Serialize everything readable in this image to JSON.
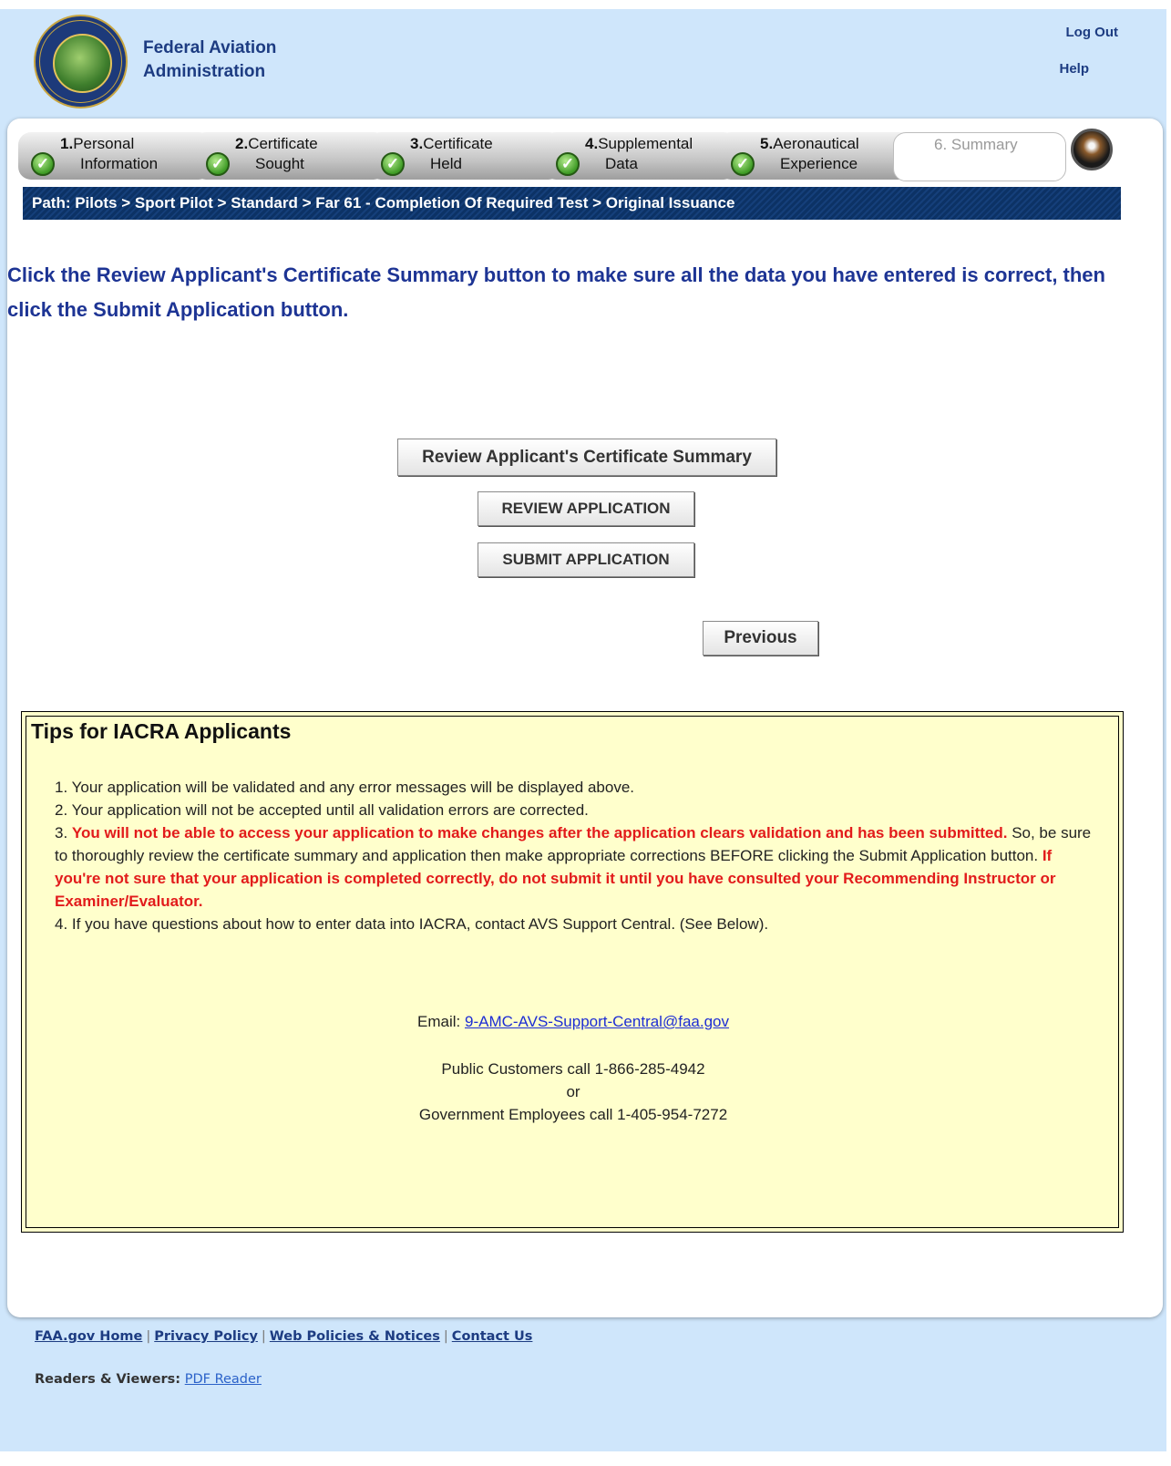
{
  "header": {
    "org_line1": "Federal Aviation",
    "org_line2": "Administration",
    "logout": "Log Out",
    "help": "Help"
  },
  "steps": [
    {
      "num": "1.",
      "line1": "Personal",
      "line2": "Information",
      "complete": true
    },
    {
      "num": "2.",
      "line1": "Certificate",
      "line2": "Sought",
      "complete": true
    },
    {
      "num": "3.",
      "line1": "Certificate",
      "line2": "Held",
      "complete": true
    },
    {
      "num": "4.",
      "line1": "Supplemental",
      "line2": "Data",
      "complete": true
    },
    {
      "num": "5.",
      "line1": "Aeronautical",
      "line2": "Experience",
      "complete": true
    },
    {
      "num": "",
      "line1": "6. Summary",
      "line2": "",
      "complete": false
    }
  ],
  "path": "Path:  Pilots  >  Sport Pilot  >  Standard  >  Far 61 - Completion Of Required Test  >  Original Issuance",
  "instruction": "Click the Review Applicant's Certificate Summary button to make sure all the data you have entered is correct, then click the Submit Application button.",
  "buttons": {
    "review_summary": "Review Applicant's Certificate Summary",
    "review_application": "REVIEW APPLICATION",
    "submit_application": "SUBMIT APPLICATION",
    "previous": "Previous"
  },
  "tips": {
    "title": "Tips for IACRA Applicants",
    "item1": "1.   Your application will be validated and any error messages will be displayed above.",
    "item2": "2.   Your application will not be accepted until all validation errors are corrected.",
    "item3_num": "3.   ",
    "item3_red1": "You will not be able to access your application to make changes after the application clears validation and has been submitted.",
    "item3_text": " So, be sure to thoroughly review the certificate summary and application then make appropriate corrections BEFORE clicking the Submit Application button.  ",
    "item3_red2": "If you're not sure that your application is completed correctly, do not submit it until you have consulted your Recommending Instructor or Examiner/Evaluator.",
    "item4": "4.   If you have questions about how to enter data into IACRA, contact AVS Support Central. (See Below).",
    "email_label": "Email: ",
    "email": "9-AMC-AVS-Support-Central@faa.gov",
    "public_call": "Public Customers call 1-866-285-4942",
    "or": "or",
    "gov_call": "Government Employees call 1-405-954-7272"
  },
  "footer": {
    "links": [
      "FAA.gov Home",
      "Privacy Policy",
      "Web Policies & Notices",
      "Contact Us"
    ],
    "readers_label": "Readers & Viewers:",
    "pdf_reader": "PDF Reader"
  },
  "icons": {
    "faa_logo": "faa-seal",
    "step_check": "check-circle-icon",
    "globe": "globe-icon"
  }
}
